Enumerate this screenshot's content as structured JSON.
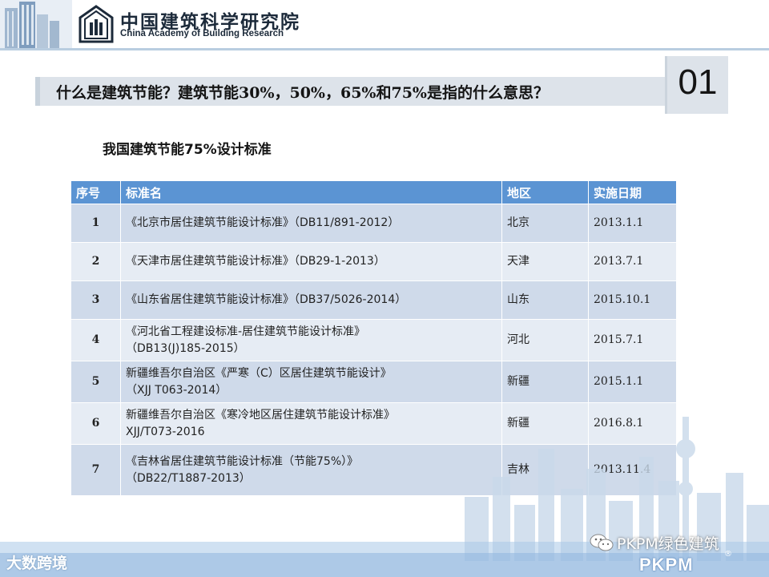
{
  "header": {
    "org_name_cn": "中国建筑科学研究院",
    "org_name_en": "China Academy of Building Research"
  },
  "question": {
    "text": "什么是建筑节能？建筑节能30%，50%，65%和75%是指的什么意思？",
    "section_number": "01"
  },
  "subtitle": "我国建筑节能75%设计标准",
  "table": {
    "headers": [
      "序号",
      "标准名",
      "地区",
      "实施日期"
    ],
    "rows": [
      {
        "no": "1",
        "name_line1": "《北京市居住建筑节能设计标准》（DB11/891-2012）",
        "name_line2": "",
        "region": "北京",
        "date": "2013.1.1"
      },
      {
        "no": "2",
        "name_line1": "《天津市居住建筑节能设计标准》（DB29-1-2013）",
        "name_line2": "",
        "region": "天津",
        "date": "2013.7.1"
      },
      {
        "no": "3",
        "name_line1": "《山东省居住建筑节能设计标准》（DB37/5026-2014）",
        "name_line2": "",
        "region": "山东",
        "date": "2015.10.1"
      },
      {
        "no": "4",
        "name_line1": "《河北省工程建设标准-居住建筑节能设计标准》",
        "name_line2": "（DB13(J)185-2015）",
        "region": "河北",
        "date": "2015.7.1"
      },
      {
        "no": "5",
        "name_line1": "新疆维吾尔自治区《严寒（C）区居住建筑节能设计》",
        "name_line2": "（XJJ T063-2014）",
        "region": "新疆",
        "date": "2015.1.1"
      },
      {
        "no": "6",
        "name_line1": "新疆维吾尔自治区《寒冷地区居住建筑节能设计标准》",
        "name_line2": "XJJ/T073-2016",
        "region": "新疆",
        "date": "2016.8.1"
      },
      {
        "no": "7",
        "name_line1": "《吉林省居住建筑节能设计标准（节能75%）》",
        "name_line2": "（DB22/T1887-2013）",
        "region": "吉林",
        "date": "2013.11.4"
      }
    ]
  },
  "watermarks": {
    "left": "大数跨境",
    "right": "PKPM绿色建筑",
    "brand": "PKPM",
    "reg_mark": "®"
  },
  "colors": {
    "table_header": "#5b94d3",
    "row_odd": "#cfdaea",
    "row_even": "#e6ecf4",
    "banner": "#dde3ea"
  }
}
